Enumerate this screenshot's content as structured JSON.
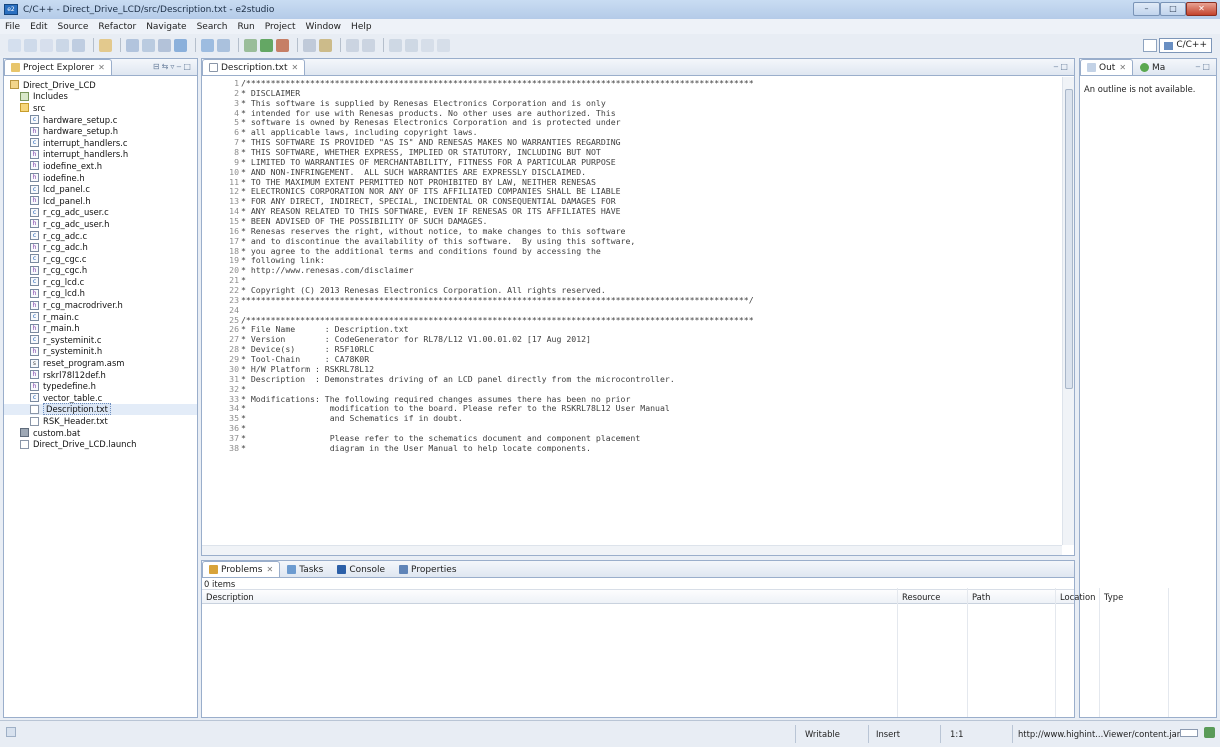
{
  "window": {
    "title": "C/C++ - Direct_Drive_LCD/src/Description.txt - e2studio",
    "app_icon": "e2",
    "controls": {
      "minimize": "–",
      "maximize": "□",
      "close": "✕"
    }
  },
  "menu": [
    "File",
    "Edit",
    "Source",
    "Refactor",
    "Navigate",
    "Search",
    "Run",
    "Project",
    "Window",
    "Help"
  ],
  "perspective": {
    "label": "C/C++"
  },
  "project_explorer": {
    "tab_label": "Project Explorer",
    "tab_close": "✕",
    "items": [
      {
        "label": "Direct_Drive_LCD",
        "icon": "project-icon",
        "indent": 0
      },
      {
        "label": "Includes",
        "icon": "includes-icon",
        "indent": 1
      },
      {
        "label": "src",
        "icon": "folder-icon",
        "indent": 1
      },
      {
        "label": "hardware_setup.c",
        "icon": "c-file-icon",
        "indent": 2
      },
      {
        "label": "hardware_setup.h",
        "icon": "h-file-icon",
        "indent": 2
      },
      {
        "label": "interrupt_handlers.c",
        "icon": "c-file-icon",
        "indent": 2
      },
      {
        "label": "interrupt_handlers.h",
        "icon": "h-file-icon",
        "indent": 2
      },
      {
        "label": "iodefine_ext.h",
        "icon": "h-file-icon",
        "indent": 2
      },
      {
        "label": "iodefine.h",
        "icon": "h-file-icon",
        "indent": 2
      },
      {
        "label": "lcd_panel.c",
        "icon": "c-file-icon",
        "indent": 2
      },
      {
        "label": "lcd_panel.h",
        "icon": "h-file-icon",
        "indent": 2
      },
      {
        "label": "r_cg_adc_user.c",
        "icon": "c-file-icon",
        "indent": 2
      },
      {
        "label": "r_cg_adc_user.h",
        "icon": "h-file-icon",
        "indent": 2
      },
      {
        "label": "r_cg_adc.c",
        "icon": "c-file-icon",
        "indent": 2
      },
      {
        "label": "r_cg_adc.h",
        "icon": "h-file-icon",
        "indent": 2
      },
      {
        "label": "r_cg_cgc.c",
        "icon": "c-file-icon",
        "indent": 2
      },
      {
        "label": "r_cg_cgc.h",
        "icon": "h-file-icon",
        "indent": 2
      },
      {
        "label": "r_cg_lcd.c",
        "icon": "c-file-icon",
        "indent": 2
      },
      {
        "label": "r_cg_lcd.h",
        "icon": "h-file-icon",
        "indent": 2
      },
      {
        "label": "r_cg_macrodriver.h",
        "icon": "h-file-icon",
        "indent": 2
      },
      {
        "label": "r_main.c",
        "icon": "c-file-icon",
        "indent": 2
      },
      {
        "label": "r_main.h",
        "icon": "h-file-icon",
        "indent": 2
      },
      {
        "label": "r_systeminit.c",
        "icon": "c-file-icon",
        "indent": 2
      },
      {
        "label": "r_systeminit.h",
        "icon": "h-file-icon",
        "indent": 2
      },
      {
        "label": "reset_program.asm",
        "icon": "asm-file-icon",
        "indent": 2
      },
      {
        "label": "rskrl78l12def.h",
        "icon": "h-file-icon",
        "indent": 2
      },
      {
        "label": "typedefine.h",
        "icon": "h-file-icon",
        "indent": 2
      },
      {
        "label": "vector_table.c",
        "icon": "c-file-icon",
        "indent": 2
      },
      {
        "label": "Description.txt",
        "icon": "text-file-icon",
        "indent": 2,
        "selected": true
      },
      {
        "label": "RSK_Header.txt",
        "icon": "text-file-icon",
        "indent": 2
      },
      {
        "label": "custom.bat",
        "icon": "bat-file-icon",
        "indent": 1
      },
      {
        "label": "Direct_Drive_LCD.launch",
        "icon": "launch-file-icon",
        "indent": 1
      }
    ]
  },
  "editor": {
    "tab_label": "Description.txt",
    "tab_close": "✕",
    "lines": [
      "/*******************************************************************************************************",
      "* DISCLAIMER",
      "* This software is supplied by Renesas Electronics Corporation and is only",
      "* intended for use with Renesas products. No other uses are authorized. This",
      "* software is owned by Renesas Electronics Corporation and is protected under",
      "* all applicable laws, including copyright laws.",
      "* THIS SOFTWARE IS PROVIDED \"AS IS\" AND RENESAS MAKES NO WARRANTIES REGARDING",
      "* THIS SOFTWARE, WHETHER EXPRESS, IMPLIED OR STATUTORY, INCLUDING BUT NOT",
      "* LIMITED TO WARRANTIES OF MERCHANTABILITY, FITNESS FOR A PARTICULAR PURPOSE",
      "* AND NON-INFRINGEMENT.  ALL SUCH WARRANTIES ARE EXPRESSLY DISCLAIMED.",
      "* TO THE MAXIMUM EXTENT PERMITTED NOT PROHIBITED BY LAW, NEITHER RENESAS",
      "* ELECTRONICS CORPORATION NOR ANY OF ITS AFFILIATED COMPANIES SHALL BE LIABLE",
      "* FOR ANY DIRECT, INDIRECT, SPECIAL, INCIDENTAL OR CONSEQUENTIAL DAMAGES FOR",
      "* ANY REASON RELATED TO THIS SOFTWARE, EVEN IF RENESAS OR ITS AFFILIATES HAVE",
      "* BEEN ADVISED OF THE POSSIBILITY OF SUCH DAMAGES.",
      "* Renesas reserves the right, without notice, to make changes to this software",
      "* and to discontinue the availability of this software.  By using this software,",
      "* you agree to the additional terms and conditions found by accessing the",
      "* following link:",
      "* http://www.renesas.com/disclaimer",
      "*",
      "* Copyright (C) 2013 Renesas Electronics Corporation. All rights reserved.",
      "*******************************************************************************************************/",
      "",
      "/*******************************************************************************************************",
      "* File Name      : Description.txt",
      "* Version        : CodeGenerator for RL78/L12 V1.00.01.02 [17 Aug 2012]",
      "* Device(s)      : R5F10RLC",
      "* Tool-Chain     : CA78K0R",
      "* H/W Platform : RSKRL78L12",
      "* Description  : Demonstrates driving of an LCD panel directly from the microcontroller.",
      "*",
      "* Modifications: The following required changes assumes there has been no prior",
      "*                 modification to the board. Please refer to the RSKRL78L12 User Manual",
      "*                 and Schematics if in doubt.",
      "*",
      "*                 Please refer to the schematics document and component placement",
      "*                 diagram in the User Manual to help locate components."
    ]
  },
  "outline": {
    "tabs": [
      {
        "label": "Out",
        "close": "✕"
      },
      {
        "label": "Ma"
      }
    ],
    "message": "An outline is not available."
  },
  "problems": {
    "tabs": [
      {
        "label": "Problems",
        "close": "✕"
      },
      {
        "label": "Tasks"
      },
      {
        "label": "Console"
      },
      {
        "label": "Properties"
      }
    ],
    "count": "0 items",
    "columns": [
      "Description",
      "Resource",
      "Path",
      "Location",
      "Type"
    ]
  },
  "status": {
    "writable": "Writable",
    "mode": "Insert",
    "position": "1:1",
    "message": "http://www.highint...Viewer/content.jar"
  },
  "colors": {
    "accent": "#2a6fc0",
    "panel_border": "#9aaecb"
  }
}
